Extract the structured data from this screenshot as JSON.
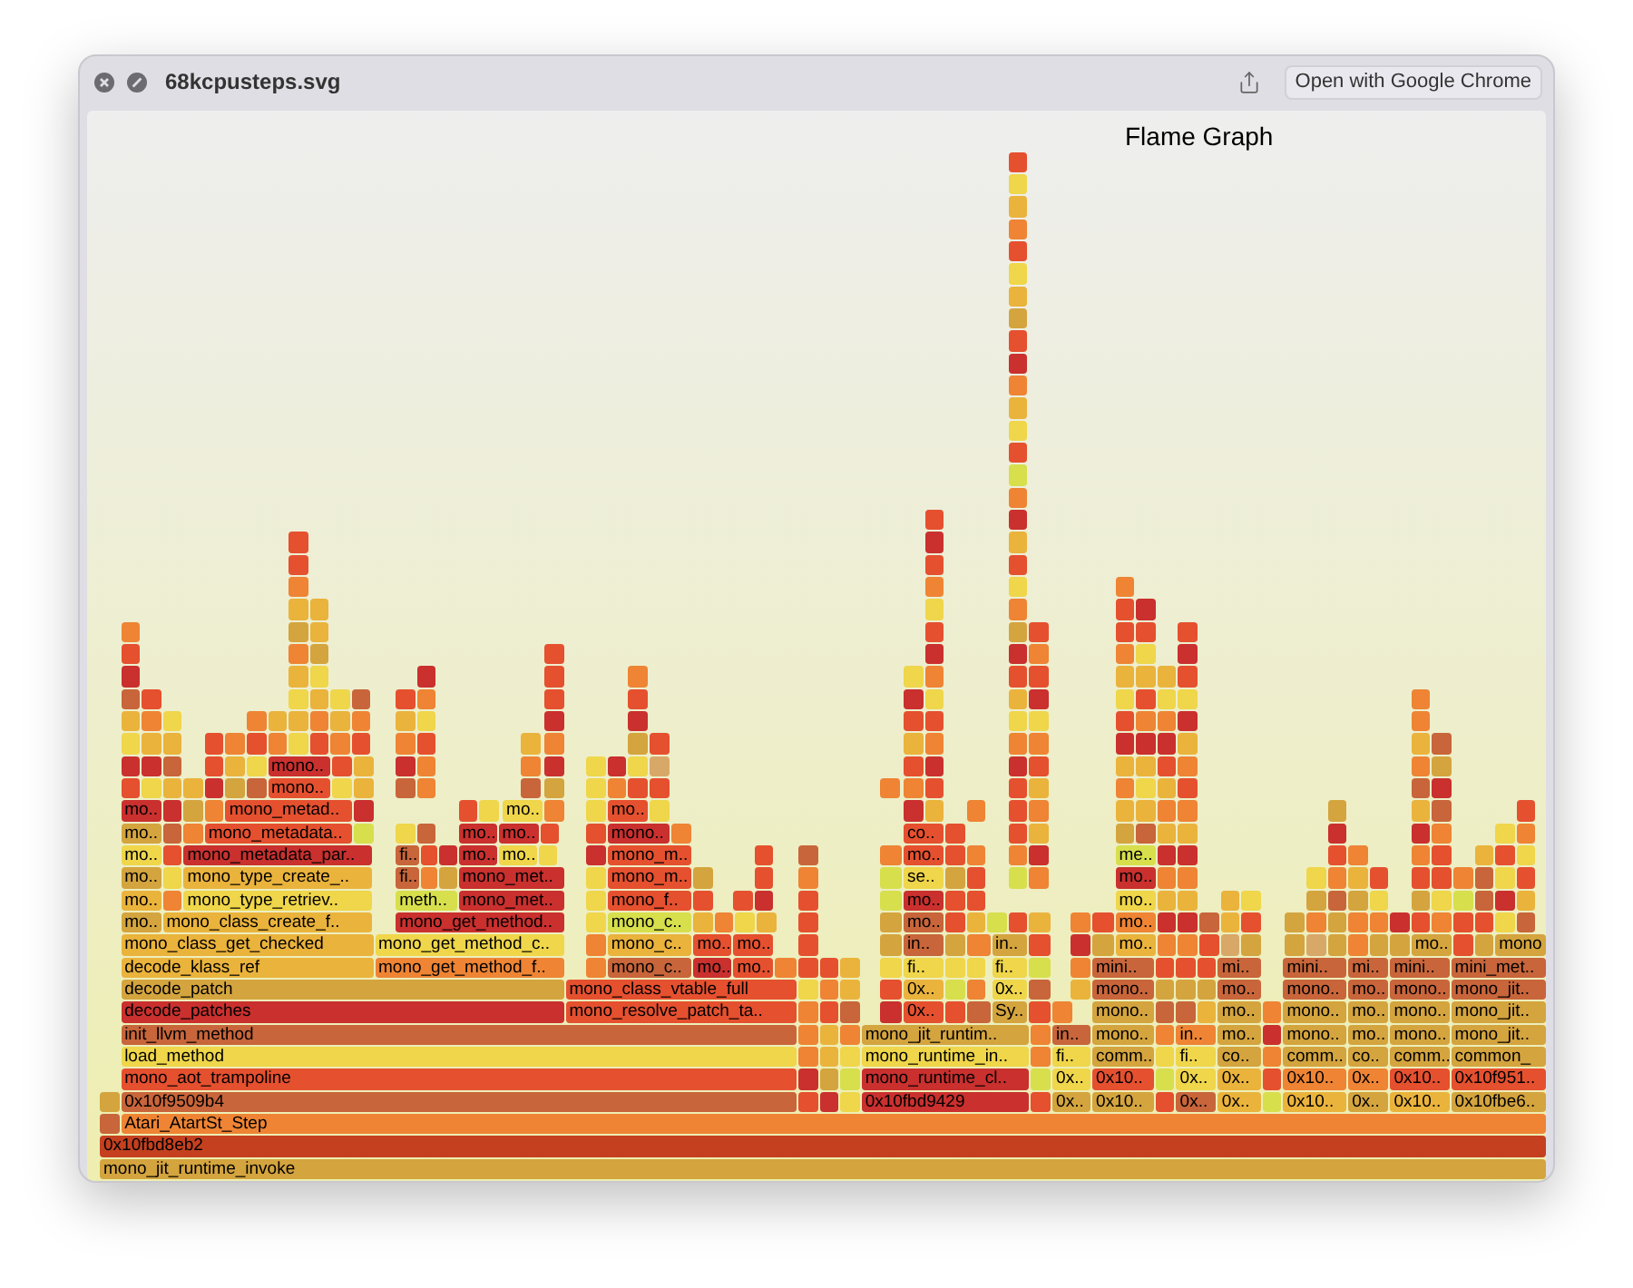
{
  "window": {
    "title": "68kcpusteps.svg",
    "open_button": "Open with Google Chrome"
  },
  "flame_graph": {
    "title": "Flame Graph",
    "levels": [
      [
        "mono.."
      ],
      [
        "mono.."
      ],
      [
        "mo..",
        "mono_metad..",
        "mo..",
        "mo.."
      ],
      [
        "mo..",
        "mono_metadata..",
        "mo..",
        "mo..",
        "mono..",
        "co.."
      ],
      [
        "mo..",
        "mono_metadata_par..",
        "fi..",
        "mo..",
        "mo..",
        "mono_m..",
        "mo..",
        "me.."
      ],
      [
        "mo..",
        "mono_type_create_..",
        "fi..",
        "mono_met..",
        "mono_m..",
        "se..",
        "mo.."
      ],
      [
        "mo..",
        "mono_type_retriev..",
        "meth..",
        "mono_met..",
        "mono_f..",
        "mo..",
        "mo.."
      ],
      [
        "mo..",
        "mono_class_create_f..",
        "mono_get_method..",
        "mono_c..",
        "mo..",
        "mo.."
      ],
      [
        "mono_class_get_checked",
        "mono_get_method_c..",
        "mono_c..",
        "mo..",
        "mo..",
        "in..",
        "in..",
        "mo..",
        "mo..",
        "mono"
      ],
      [
        "decode_klass_ref",
        "mono_get_method_f..",
        "mono_c..",
        "mo..",
        "mo..",
        "fi..",
        "fi..",
        "mini..",
        "mi..",
        "mini..",
        "mi..",
        "mini..",
        "mini_met.."
      ],
      [
        "decode_patch",
        "mono_class_vtable_full",
        "0x..",
        "0x..",
        "mono..",
        "mo..",
        "mono..",
        "mo..",
        "mono..",
        "mono_jit.."
      ],
      [
        "decode_patches",
        "mono_resolve_patch_ta..",
        "0x..",
        "Sy..",
        "mono..",
        "mo..",
        "mono..",
        "mo..",
        "mono..",
        "mono_jit.."
      ],
      [
        "init_llvm_method",
        "mono_jit_runtim..",
        "in..",
        "mono..",
        "in..",
        "mo..",
        "mono..",
        "mo..",
        "mono..",
        "mono_jit.."
      ],
      [
        "load_method",
        "mono_runtime_in..",
        "fi..",
        "comm..",
        "fi..",
        "co..",
        "comm..",
        "co..",
        "comm..",
        "common_"
      ],
      [
        "mono_aot_trampoline",
        "mono_runtime_cl..",
        "0x..",
        "0x10..",
        "0x..",
        "0x..",
        "0x10..",
        "0x..",
        "0x10..",
        "0x10f951.."
      ],
      [
        "0x10f9509b4",
        "0x10fbd9429",
        "0x..",
        "0x10..",
        "0x..",
        "0x..",
        "0x10..",
        "0x..",
        "0x10..",
        "0x10fbe6.."
      ],
      [
        "Atari_AtartSt_Step"
      ],
      [
        "0x10fbd8eb2"
      ],
      [
        "mono_jit_runtime_invoke"
      ]
    ]
  }
}
